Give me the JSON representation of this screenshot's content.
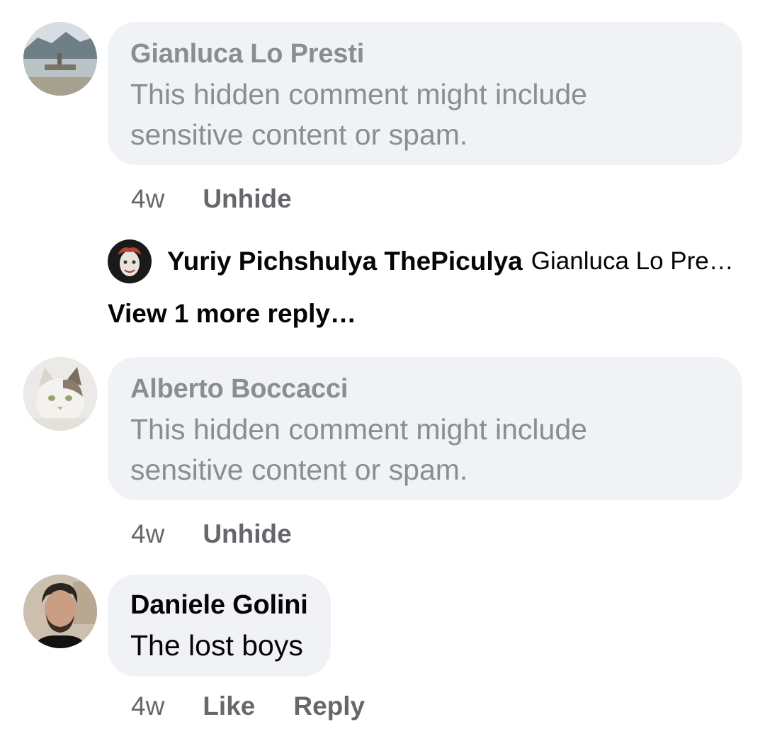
{
  "comments": [
    {
      "author": "Gianluca Lo Presti",
      "text": "This hidden comment might include sensitive content or spam.",
      "text_line1": "This hidden comment might include",
      "text_line2": "sensitive content or spam.",
      "time": "4w",
      "action": "Unhide"
    },
    {
      "author": "Alberto Boccacci",
      "text": "This hidden comment might include sensitive content or spam.",
      "text_line1": "This hidden comment might include",
      "text_line2": "sensitive content or spam.",
      "time": "4w",
      "action": "Unhide"
    },
    {
      "author": "Daniele Golini",
      "text": "The lost boys",
      "time": "4w",
      "like": "Like",
      "reply": "Reply"
    }
  ],
  "reply_preview": {
    "author": "Yuriy Pichshulya ThePiculya",
    "snippet": "Gianluca Lo Pre…"
  },
  "view_more": "View 1 more reply…",
  "colors": {
    "bubble_bg": "#f0f2f5",
    "muted_text": "#8a8d91",
    "action_text": "#65676b",
    "primary_text": "#050505"
  }
}
